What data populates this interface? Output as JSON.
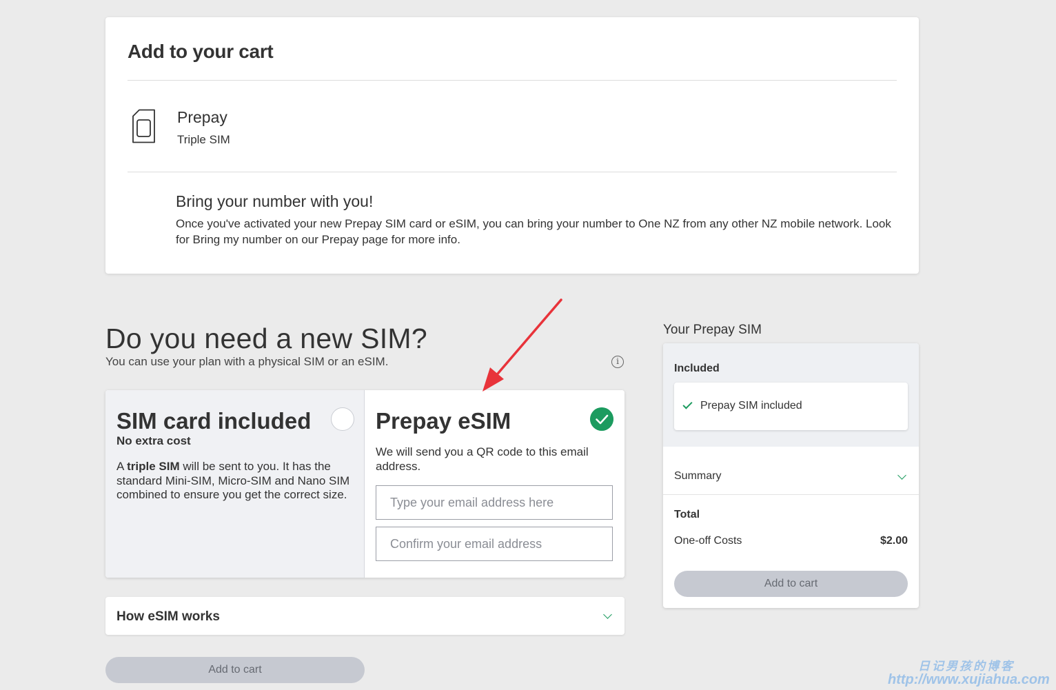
{
  "cart": {
    "title": "Add to your cart",
    "plan_name": "Prepay",
    "plan_sub": "Triple SIM",
    "bring_title": "Bring your number with you!",
    "bring_text": "Once you've activated your new Prepay SIM card or eSIM, you can bring your number to One NZ from any other NZ mobile network. Look for Bring my number on our Prepay page for more info."
  },
  "sim_section": {
    "title": "Do you need a new SIM?",
    "subtitle": "You can use your plan with a physical SIM or an eSIM."
  },
  "options": {
    "sim_card": {
      "title": "SIM card included",
      "cost": "No extra cost",
      "desc_prefix": "A ",
      "desc_bold": "triple SIM",
      "desc_rest": " will be sent to you. It has the standard Mini-SIM, Micro-SIM and Nano SIM combined to ensure you get the correct size.",
      "selected": false
    },
    "esim": {
      "title": "Prepay eSIM",
      "desc": "We will send you a QR code to this email address.",
      "email_placeholder": "Type your email address here",
      "confirm_placeholder": "Confirm your email address",
      "selected": true
    }
  },
  "how_esim": {
    "label": "How eSIM works"
  },
  "bottom_button": {
    "label": "Add to cart"
  },
  "sidebar": {
    "title": "Your Prepay SIM",
    "included_label": "Included",
    "included_item": "Prepay SIM included",
    "summary_label": "Summary",
    "total_label": "Total",
    "oneoff_label": "One-off Costs",
    "oneoff_value": "$2.00",
    "button_label": "Add to cart"
  },
  "watermark": {
    "line1": "日记男孩的博客",
    "line2": "http://www.xujiahua.com"
  },
  "colors": {
    "accent_green": "#1c9b5f",
    "annotation_red": "#e8333a",
    "disabled_button": "#c6c9d1",
    "page_background": "#ebebeb"
  }
}
